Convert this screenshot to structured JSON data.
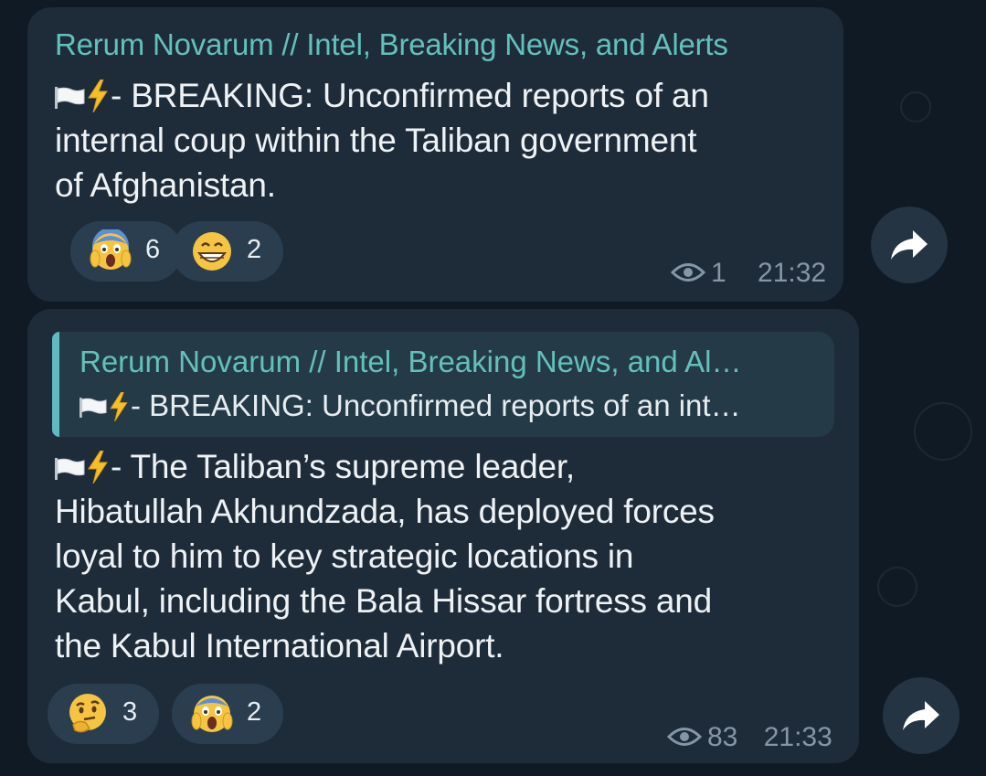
{
  "messages": [
    {
      "sender": "Rerum Novarum // Intel, Breaking News, and Alerts",
      "text": "- BREAKING: Unconfirmed reports of an\ninternal coup within the Taliban government\nof Afghanistan.",
      "prefix_icons": [
        "white-flag-icon",
        "lightning-icon"
      ],
      "reactions": [
        {
          "emoji": "screaming-face-icon",
          "count": "6"
        },
        {
          "emoji": "grinning-face-icon",
          "count": "2"
        }
      ],
      "views": "1",
      "time": "21:32"
    },
    {
      "reply": {
        "sender": "Rerum Novarum // Intel, Breaking News, and Al…",
        "text": "- BREAKING: Unconfirmed reports of an int…"
      },
      "text": "- The Taliban’s supreme leader,\nHibatullah Akhundzada, has deployed forces\nloyal to him to key strategic locations in\nKabul, including the Bala Hissar fortress and\nthe Kabul International Airport.",
      "prefix_icons": [
        "white-flag-icon",
        "lightning-icon"
      ],
      "reactions": [
        {
          "emoji": "thinking-face-icon",
          "count": "3"
        },
        {
          "emoji": "screaming-face-icon",
          "count": "2"
        }
      ],
      "views": "83",
      "time": "21:33"
    }
  ],
  "colors": {
    "background": "#0f1a24",
    "bubble": "#1e2c3a",
    "accent": "#63c0bd",
    "reaction_bg": "#2b3e50",
    "meta": "#8596a6"
  }
}
